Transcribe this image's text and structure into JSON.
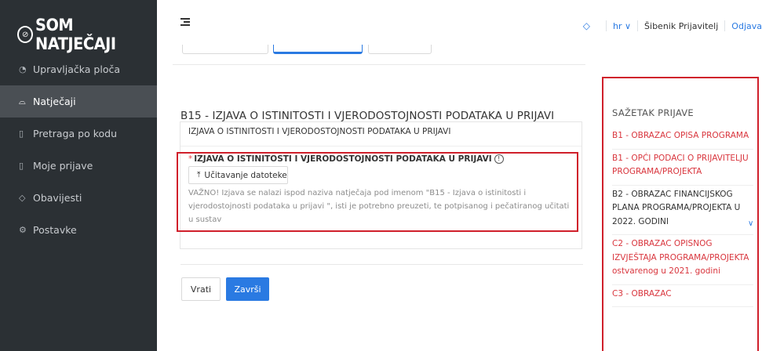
{
  "app": {
    "logo_text": "SOM NATJEČAJI",
    "logo_mark": "⊘"
  },
  "sidebar": {
    "items": [
      {
        "icon": "dashboard-icon",
        "glyph": "◔",
        "label": "Upravljačka ploča"
      },
      {
        "icon": "folder-open-icon",
        "glyph": "⌓",
        "label": "Natječaji"
      },
      {
        "icon": "document-search-icon",
        "glyph": "▯",
        "label": "Pretraga po kodu"
      },
      {
        "icon": "document-icon",
        "glyph": "▯",
        "label": "Moje prijave"
      },
      {
        "icon": "bell-icon",
        "glyph": "◇",
        "label": "Obavijesti"
      },
      {
        "icon": "gear-icon",
        "glyph": "⚙",
        "label": "Postavke"
      }
    ],
    "active_index": 1
  },
  "header": {
    "bell_icon": "bell-icon",
    "bell_glyph": "◇",
    "language": "hr ∨",
    "user": "Šibenik Prijavitelj",
    "logout": "Odjava"
  },
  "form": {
    "title": "B15 - IZJAVA O ISTINITOSTI I VJERODOSTOJNOSTI PODATAKA U PRIJAVI",
    "card_title": "IZJAVA O ISTINITOSTI I VJERODOSTOJNOSTI PODATAKA U PRIJAVI",
    "field_label": "IZJAVA O ISTINITOSTI I VJERODOSTOJNOSTI PODATAKA U PRIJAVI",
    "required_mark": "*",
    "info_glyph": "!",
    "upload_glyph": "⤒",
    "upload_label": "Učitavanje datoteke",
    "note": "VAŽNO! Izjava se nalazi ispod naziva natječaja pod imenom \"B15 - Izjava o istinitosti i vjerodostojnosti podataka u prijavi \", isti je potrebno preuzeti, te potpisanog i pečatiranog učitati u sustav",
    "back_label": "Vrati",
    "finish_label": "Završi"
  },
  "summary": {
    "title": "SAŽETAK PRIJAVE",
    "chevron": "∨",
    "items": [
      {
        "label": "B1 - OBRAZAC OPISA PROGRAMA",
        "status": "red"
      },
      {
        "label": "B1 - OPĆI PODACI O PRIJAVITELJU PROGRAMA/PROJEKTA",
        "status": "red"
      },
      {
        "label": "B2 - OBRAZAC FINANCIJSKOG PLANA PROGRAMA/PROJEKTA U 2022. GODINI",
        "status": "dark"
      },
      {
        "label": "C2 - OBRAZAC OPISNOG IZVJEŠTAJA PROGRAMA/PROJEKTA ostvarenog u 2021. godini",
        "status": "red"
      },
      {
        "label": "C3 - OBRAZAC",
        "status": "red"
      }
    ]
  },
  "colors": {
    "accent": "#2a7ae2",
    "highlight": "#d0202b",
    "sidebar": "#2b3034",
    "error": "#d9363e"
  }
}
